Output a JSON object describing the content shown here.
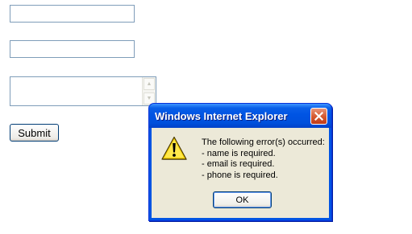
{
  "form": {
    "name_value": "",
    "email_value": "",
    "phone_value": "",
    "submit_label": "Submit"
  },
  "dialog": {
    "title": "Windows Internet Explorer",
    "icon": "warning-icon",
    "message_lines": [
      "The following error(s) occurred:",
      "- name is required.",
      "- email is required.",
      "- phone is required."
    ],
    "ok_label": "OK",
    "colors": {
      "titlebar": "#0054e3",
      "close_button": "#d5572e",
      "client_background": "#ece9d8"
    }
  }
}
